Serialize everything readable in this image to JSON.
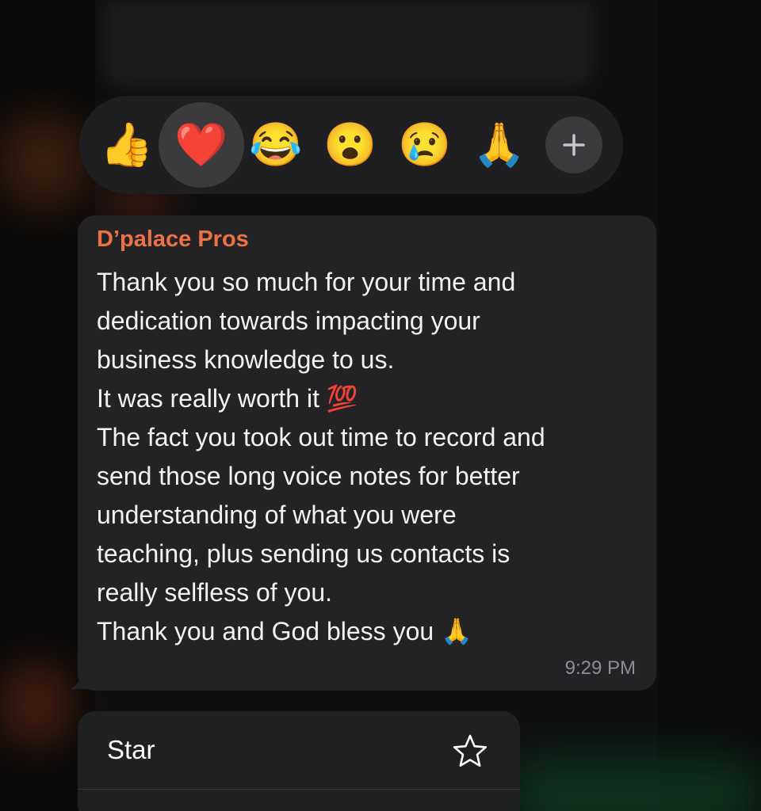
{
  "reactions": {
    "items": [
      {
        "emoji": "👍",
        "name": "thumbs-up",
        "selected": false
      },
      {
        "emoji": "❤️",
        "name": "red-heart",
        "selected": true
      },
      {
        "emoji": "😂",
        "name": "tears-of-joy",
        "selected": false
      },
      {
        "emoji": "😮",
        "name": "open-mouth",
        "selected": false
      },
      {
        "emoji": "😢",
        "name": "crying-face",
        "selected": false
      },
      {
        "emoji": "🙏",
        "name": "folded-hands",
        "selected": false
      }
    ],
    "add_icon": "plus-icon"
  },
  "message": {
    "sender": "D’palace Pros",
    "sender_color": "#ee7145",
    "lines": [
      "Thank you so much for your time and",
      "dedication towards impacting your",
      "business knowledge to us.",
      "It was really worth it 💯",
      "The fact you took out time to record and",
      "send those long voice notes for better",
      "understanding of what you were",
      "teaching, plus sending us contacts is",
      "really selfless of you.",
      "Thank you and God bless you 🙏"
    ],
    "time": "9:29 PM"
  },
  "menu": {
    "items": [
      {
        "label": "Star",
        "icon": "star-icon"
      }
    ]
  }
}
